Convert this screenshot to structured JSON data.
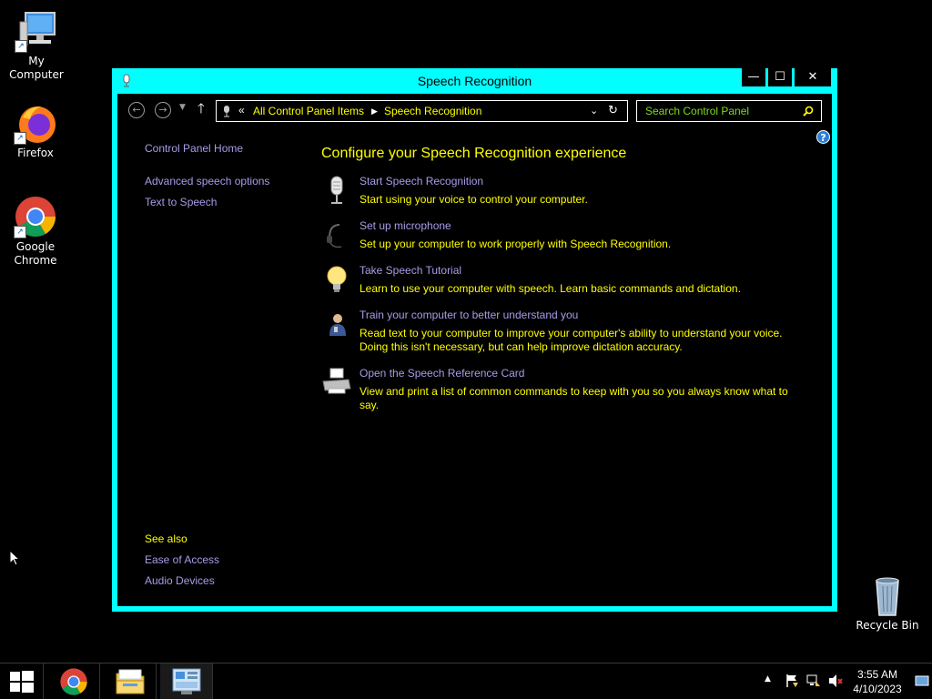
{
  "desktop": {
    "icons": [
      {
        "label": "My Computer"
      },
      {
        "label": "Firefox"
      },
      {
        "label": "Google Chrome"
      },
      {
        "label": "Recycle Bin"
      }
    ]
  },
  "window": {
    "title": "Speech Recognition",
    "accent_color": "#00ffff",
    "buttons": {
      "minimize": "—",
      "maximize": "☐",
      "close": "✕"
    }
  },
  "addressbar": {
    "prefix": "«",
    "crumbs": [
      "All Control Panel Items",
      "Speech Recognition"
    ]
  },
  "search": {
    "placeholder": "Search Control Panel"
  },
  "sidebar": {
    "home": "Control Panel Home",
    "links": [
      "Advanced speech options",
      "Text to Speech"
    ],
    "see_also_title": "See also",
    "see_also": [
      "Ease of Access",
      "Audio Devices"
    ]
  },
  "main": {
    "heading": "Configure your Speech Recognition experience",
    "tasks": [
      {
        "icon": "microphone-icon",
        "link": "Start Speech Recognition",
        "desc": "Start using your voice to control your computer."
      },
      {
        "icon": "headset-icon",
        "link": "Set up microphone",
        "desc": "Set up your computer to work properly with Speech Recognition."
      },
      {
        "icon": "lightbulb-icon",
        "link": "Take Speech Tutorial",
        "desc": "Learn to use your computer with speech.  Learn basic commands and dictation."
      },
      {
        "icon": "user-icon",
        "link": "Train your computer to better understand you",
        "desc": "Read text to your computer to improve your computer's ability to understand your voice. Doing this isn't necessary, but can help improve dictation accuracy."
      },
      {
        "icon": "printer-icon",
        "link": "Open the Speech Reference Card",
        "desc": "View and print a list of common commands to keep with you so you always know what to say."
      }
    ]
  },
  "taskbar": {
    "time": "3:55 AM",
    "date": "4/10/2023"
  },
  "colors": {
    "link": "#a99ae8",
    "text": "#ffff00",
    "search_placeholder": "#7ddc1f"
  }
}
